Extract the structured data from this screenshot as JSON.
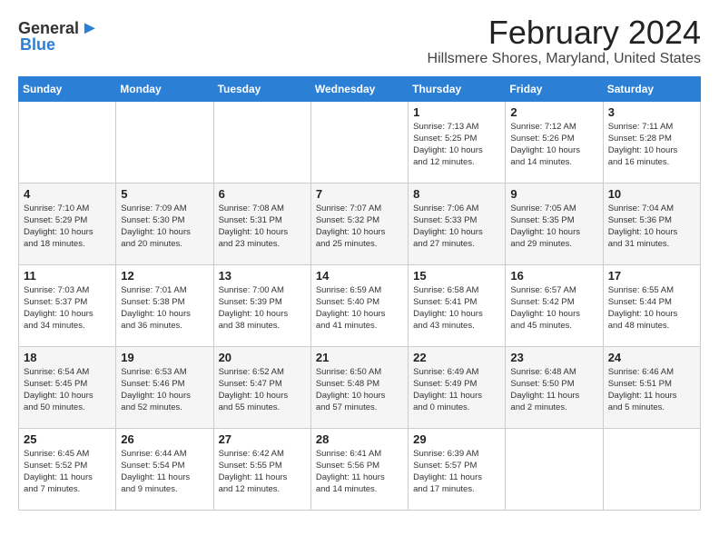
{
  "header": {
    "logo_general": "General",
    "logo_blue": "Blue",
    "month_year": "February 2024",
    "location": "Hillsmere Shores, Maryland, United States"
  },
  "weekdays": [
    "Sunday",
    "Monday",
    "Tuesday",
    "Wednesday",
    "Thursday",
    "Friday",
    "Saturday"
  ],
  "weeks": [
    [
      {
        "day": "",
        "info": ""
      },
      {
        "day": "",
        "info": ""
      },
      {
        "day": "",
        "info": ""
      },
      {
        "day": "",
        "info": ""
      },
      {
        "day": "1",
        "info": "Sunrise: 7:13 AM\nSunset: 5:25 PM\nDaylight: 10 hours\nand 12 minutes."
      },
      {
        "day": "2",
        "info": "Sunrise: 7:12 AM\nSunset: 5:26 PM\nDaylight: 10 hours\nand 14 minutes."
      },
      {
        "day": "3",
        "info": "Sunrise: 7:11 AM\nSunset: 5:28 PM\nDaylight: 10 hours\nand 16 minutes."
      }
    ],
    [
      {
        "day": "4",
        "info": "Sunrise: 7:10 AM\nSunset: 5:29 PM\nDaylight: 10 hours\nand 18 minutes."
      },
      {
        "day": "5",
        "info": "Sunrise: 7:09 AM\nSunset: 5:30 PM\nDaylight: 10 hours\nand 20 minutes."
      },
      {
        "day": "6",
        "info": "Sunrise: 7:08 AM\nSunset: 5:31 PM\nDaylight: 10 hours\nand 23 minutes."
      },
      {
        "day": "7",
        "info": "Sunrise: 7:07 AM\nSunset: 5:32 PM\nDaylight: 10 hours\nand 25 minutes."
      },
      {
        "day": "8",
        "info": "Sunrise: 7:06 AM\nSunset: 5:33 PM\nDaylight: 10 hours\nand 27 minutes."
      },
      {
        "day": "9",
        "info": "Sunrise: 7:05 AM\nSunset: 5:35 PM\nDaylight: 10 hours\nand 29 minutes."
      },
      {
        "day": "10",
        "info": "Sunrise: 7:04 AM\nSunset: 5:36 PM\nDaylight: 10 hours\nand 31 minutes."
      }
    ],
    [
      {
        "day": "11",
        "info": "Sunrise: 7:03 AM\nSunset: 5:37 PM\nDaylight: 10 hours\nand 34 minutes."
      },
      {
        "day": "12",
        "info": "Sunrise: 7:01 AM\nSunset: 5:38 PM\nDaylight: 10 hours\nand 36 minutes."
      },
      {
        "day": "13",
        "info": "Sunrise: 7:00 AM\nSunset: 5:39 PM\nDaylight: 10 hours\nand 38 minutes."
      },
      {
        "day": "14",
        "info": "Sunrise: 6:59 AM\nSunset: 5:40 PM\nDaylight: 10 hours\nand 41 minutes."
      },
      {
        "day": "15",
        "info": "Sunrise: 6:58 AM\nSunset: 5:41 PM\nDaylight: 10 hours\nand 43 minutes."
      },
      {
        "day": "16",
        "info": "Sunrise: 6:57 AM\nSunset: 5:42 PM\nDaylight: 10 hours\nand 45 minutes."
      },
      {
        "day": "17",
        "info": "Sunrise: 6:55 AM\nSunset: 5:44 PM\nDaylight: 10 hours\nand 48 minutes."
      }
    ],
    [
      {
        "day": "18",
        "info": "Sunrise: 6:54 AM\nSunset: 5:45 PM\nDaylight: 10 hours\nand 50 minutes."
      },
      {
        "day": "19",
        "info": "Sunrise: 6:53 AM\nSunset: 5:46 PM\nDaylight: 10 hours\nand 52 minutes."
      },
      {
        "day": "20",
        "info": "Sunrise: 6:52 AM\nSunset: 5:47 PM\nDaylight: 10 hours\nand 55 minutes."
      },
      {
        "day": "21",
        "info": "Sunrise: 6:50 AM\nSunset: 5:48 PM\nDaylight: 10 hours\nand 57 minutes."
      },
      {
        "day": "22",
        "info": "Sunrise: 6:49 AM\nSunset: 5:49 PM\nDaylight: 11 hours\nand 0 minutes."
      },
      {
        "day": "23",
        "info": "Sunrise: 6:48 AM\nSunset: 5:50 PM\nDaylight: 11 hours\nand 2 minutes."
      },
      {
        "day": "24",
        "info": "Sunrise: 6:46 AM\nSunset: 5:51 PM\nDaylight: 11 hours\nand 5 minutes."
      }
    ],
    [
      {
        "day": "25",
        "info": "Sunrise: 6:45 AM\nSunset: 5:52 PM\nDaylight: 11 hours\nand 7 minutes."
      },
      {
        "day": "26",
        "info": "Sunrise: 6:44 AM\nSunset: 5:54 PM\nDaylight: 11 hours\nand 9 minutes."
      },
      {
        "day": "27",
        "info": "Sunrise: 6:42 AM\nSunset: 5:55 PM\nDaylight: 11 hours\nand 12 minutes."
      },
      {
        "day": "28",
        "info": "Sunrise: 6:41 AM\nSunset: 5:56 PM\nDaylight: 11 hours\nand 14 minutes."
      },
      {
        "day": "29",
        "info": "Sunrise: 6:39 AM\nSunset: 5:57 PM\nDaylight: 11 hours\nand 17 minutes."
      },
      {
        "day": "",
        "info": ""
      },
      {
        "day": "",
        "info": ""
      }
    ]
  ]
}
